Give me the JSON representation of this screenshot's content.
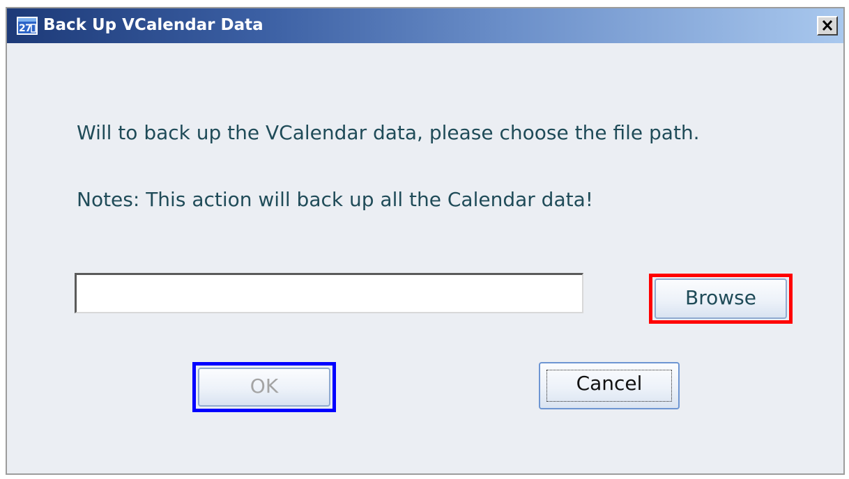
{
  "window": {
    "title": "Back Up VCalendar Data",
    "app_icon": "calendar-app-icon",
    "close_icon": "close-icon"
  },
  "dialog": {
    "message": "Will to back up the VCalendar data, please choose the file path.",
    "notes": "Notes: This action will back up all the Calendar data!",
    "path_input": {
      "value": "",
      "placeholder": ""
    },
    "browse_label": "Browse",
    "ok_label": "OK",
    "cancel_label": "Cancel",
    "ok_enabled": false
  },
  "highlights": {
    "browse_color": "#ff0000",
    "ok_color": "#0000ff"
  }
}
